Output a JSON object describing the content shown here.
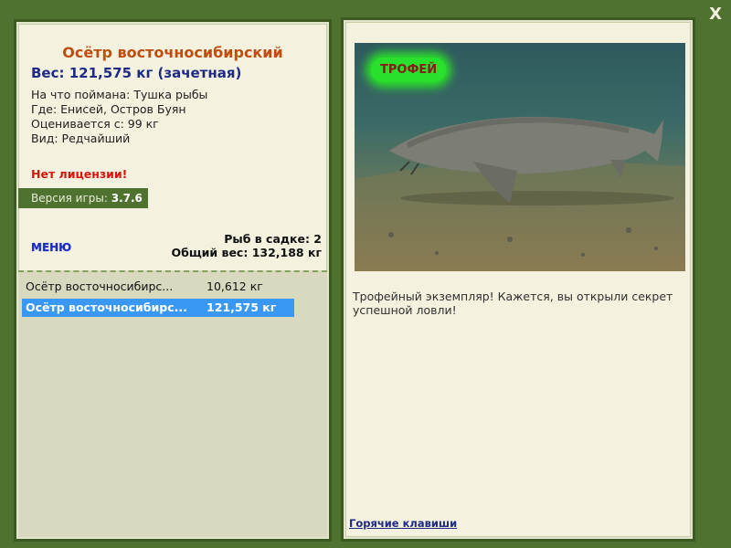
{
  "window": {
    "close_label": "X"
  },
  "fish": {
    "title": "Осётр восточносибирский",
    "weight": "Вес: 121,575 кг (зачетная)",
    "bait": "На что поймана: Тушка рыбы",
    "place": "Где: Енисей, Остров Буян",
    "valued": "Оценивается с: 99 кг",
    "kind": "Вид: Редчайший"
  },
  "license": "Нет лицензии!",
  "version": {
    "label": "Версия игры:",
    "value": "3.7.6"
  },
  "menu_label": "МЕНЮ",
  "stats": {
    "count": "Рыб в садке: 2",
    "total": "Общий вес: 132,188 кг"
  },
  "catch_list": [
    {
      "name": "Осётр восточносибирс...",
      "weight": "10,612 кг"
    },
    {
      "name": "Осётр восточносибирс...",
      "weight": "121,575 кг"
    }
  ],
  "photo": {
    "trophy_label": "ТРОФЕЙ"
  },
  "description": "Трофейный экземпляр! Кажется, вы открыли секрет успешной ловли!",
  "hotkeys_label": "Горячие клавиши",
  "colors": {
    "frame": "#4f7230",
    "panel": "#f4f1de",
    "title": "#c04d10",
    "selection": "#3a98f5"
  }
}
